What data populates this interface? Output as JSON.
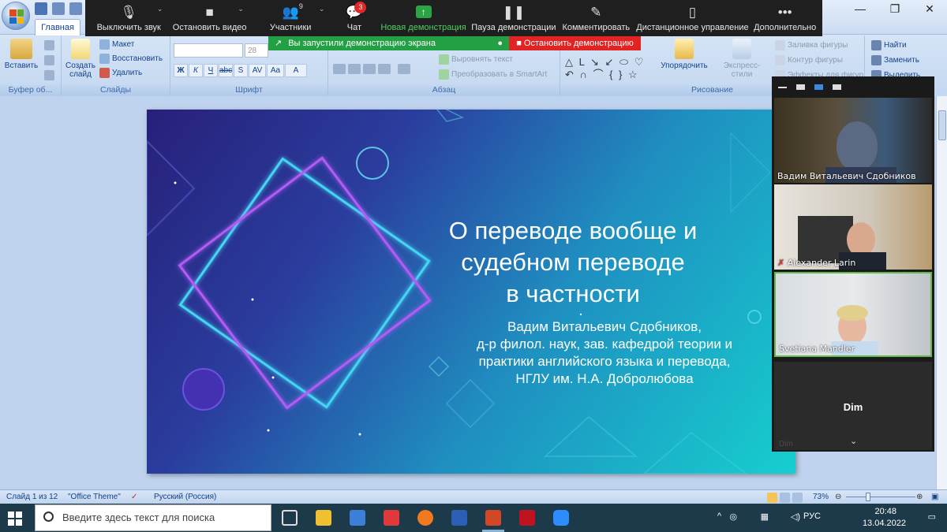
{
  "zoom": {
    "buttons": [
      {
        "label": "Выключить звук",
        "icon": "microphone-icon"
      },
      {
        "label": "Остановить видео",
        "icon": "camera-icon"
      },
      {
        "label": "Участники",
        "icon": "participants-icon",
        "count": "9"
      },
      {
        "label": "Чат",
        "icon": "chat-icon",
        "badge": "3"
      },
      {
        "label": "Новая демонстрация",
        "icon": "share-screen-icon"
      },
      {
        "label": "Пауза демонстрации",
        "icon": "pause-icon"
      },
      {
        "label": "Комментировать",
        "icon": "annotate-icon"
      },
      {
        "label": "Дистанционное управление",
        "icon": "remote-control-icon"
      },
      {
        "label": "Дополнительно",
        "icon": "more-icon"
      }
    ],
    "share_message": "Вы запустили демонстрацию экрана",
    "stop_share": "Остановить демонстрацию",
    "participants": [
      {
        "name": "Вадим Витальевич Сдобников"
      },
      {
        "name": "Alexander Larin"
      },
      {
        "name": "Svetiana Mandler"
      }
    ],
    "dim_tile": {
      "label": "Dim",
      "small": "Dim"
    }
  },
  "ribbon": {
    "tab": "Главная",
    "groups": {
      "clipboard": "Буфер об...",
      "slides": "Слайды",
      "font": "Шрифт",
      "paragraph": "Абзац",
      "drawing": "Рисование"
    },
    "paste": "Вставить",
    "new_slide": "Создать слайд",
    "layout": "Макет",
    "reset": "Восстановить",
    "delete": "Удалить",
    "font_size": "28",
    "text_align": "Выровнять текст",
    "smartart": "Преобразовать в SmartArt",
    "arrange": "Упорядочить",
    "quick_styles": "Экспресс-стили",
    "shape_fill": "Заливка фигуры",
    "shape_outline": "Контур фигуры",
    "shape_effects": "Эффекты для фигур",
    "find": "Найти",
    "replace": "Заменить",
    "select": "Выделить"
  },
  "slide": {
    "title_lines": [
      "О переводе вообще и",
      "судебном переводе",
      "в частности"
    ],
    "author_lines": [
      "Вадим Витальевич  Сдобников,",
      "д-р филол. наук, зав. кафедрой теории и",
      "практики английского языка и перевода,",
      "НГЛУ им. Н.А. Добролюбова"
    ]
  },
  "status": {
    "slide_num": "Слайд 1 из 12",
    "theme": "\"Office Theme\"",
    "language": "Русский (Россия)",
    "zoom": "73%"
  },
  "taskbar": {
    "search_placeholder": "Введите здесь текст для поиска",
    "lang": "РУС",
    "time": "20:48",
    "date": "13.04.2022"
  },
  "colors": {
    "zoom_green": "#23a043",
    "zoom_red": "#e02424",
    "ribbon_blue": "#15428b"
  }
}
